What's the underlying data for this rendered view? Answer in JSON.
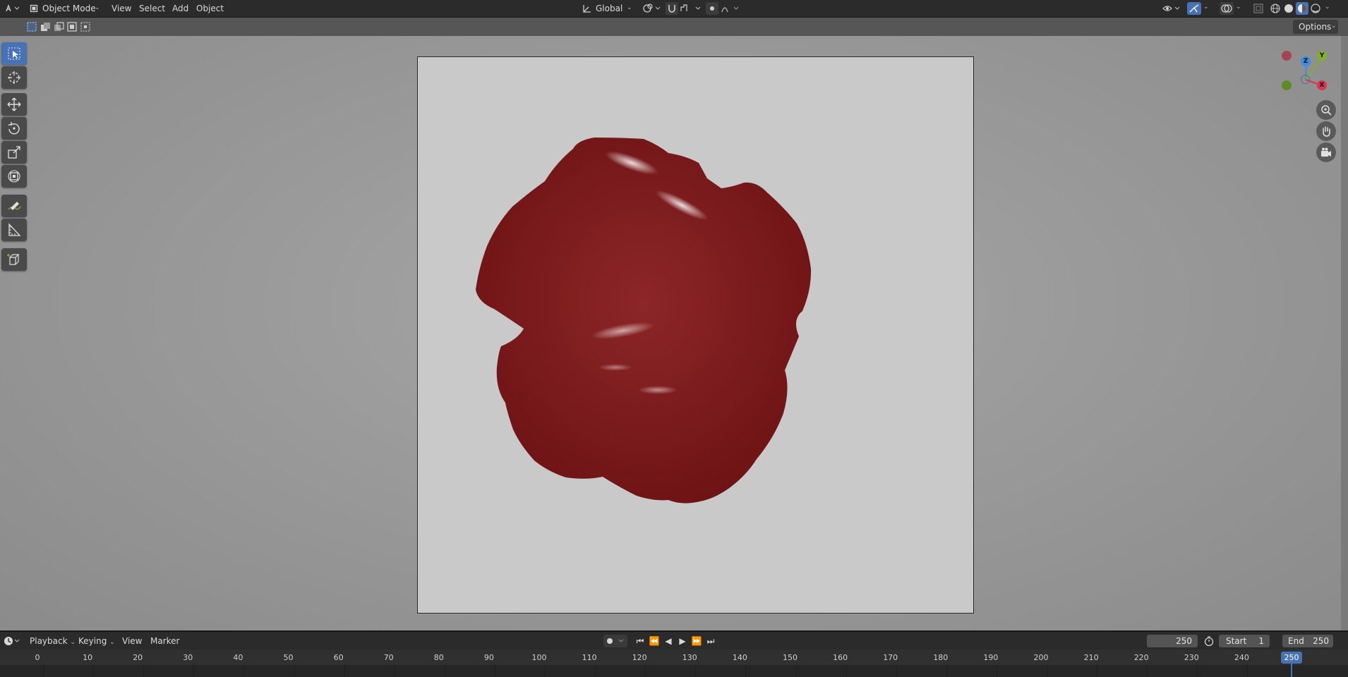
{
  "header": {
    "mode": "Object Mode",
    "menus": [
      "View",
      "Select",
      "Add",
      "Object"
    ],
    "transform_orientation": "Global"
  },
  "subheader": {
    "options_label": "Options"
  },
  "toolbar": {
    "tools": [
      "select-box",
      "cursor",
      "move",
      "rotate",
      "scale",
      "transform",
      "annotate",
      "measure",
      "add-cube"
    ]
  },
  "gizmo": {
    "x": "X",
    "y": "Y",
    "z": "Z"
  },
  "timeline": {
    "menus": [
      "Playback",
      "Keying",
      "View",
      "Marker"
    ],
    "current_frame": "250",
    "start_label": "Start",
    "start_value": "1",
    "end_label": "End",
    "end_value": "250",
    "ruler_ticks": [
      "0",
      "10",
      "20",
      "30",
      "40",
      "50",
      "60",
      "70",
      "80",
      "90",
      "100",
      "110",
      "120",
      "130",
      "140",
      "150",
      "160",
      "170",
      "180",
      "190",
      "200",
      "210",
      "220",
      "230",
      "240"
    ],
    "playhead_label": "250"
  },
  "colors": {
    "accent": "#4772b3",
    "object": "#7a1a1c",
    "axis_x": "#d6384e",
    "axis_y": "#7fb12f",
    "axis_z": "#3b8ee0"
  }
}
